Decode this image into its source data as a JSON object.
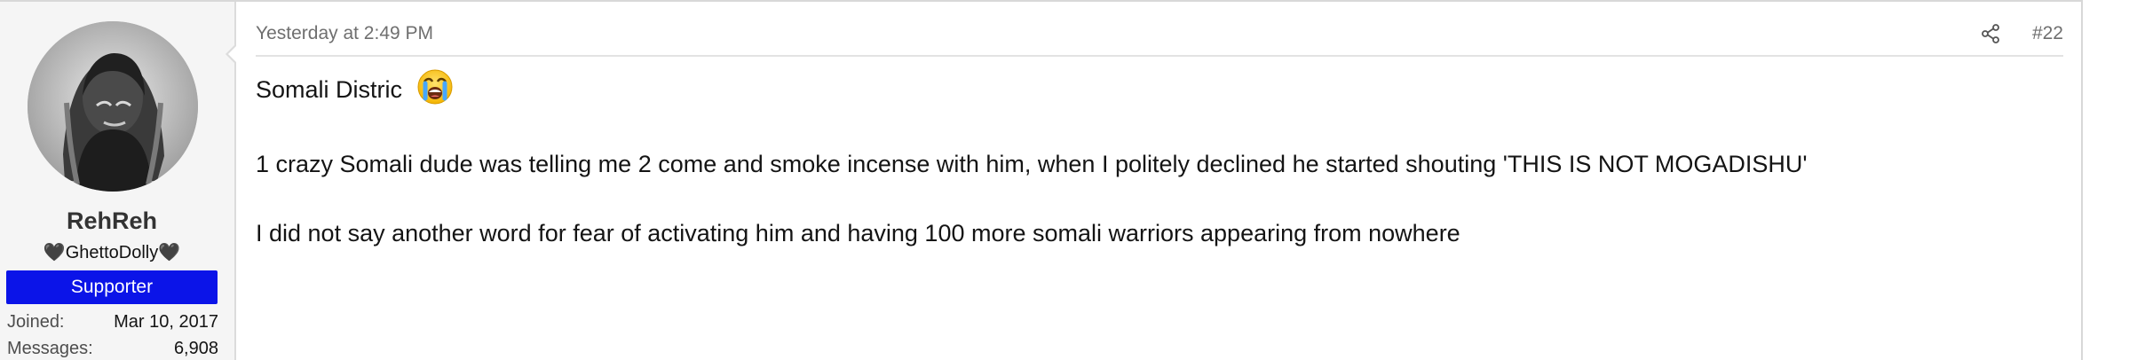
{
  "user": {
    "username": "RehReh",
    "custom_title": "🖤GhettoDolly🖤",
    "banner": "Supporter",
    "stats": {
      "joined_label": "Joined:",
      "joined_value": "Mar 10, 2017",
      "messages_label": "Messages:",
      "messages_value": "6,908"
    },
    "avatar_icon": "user-avatar"
  },
  "post": {
    "timestamp": "Yesterday at 2:49 PM",
    "share_icon": "share-icon",
    "number": "#22",
    "message": {
      "line1": "Somali Distric",
      "emoji": "loudly-crying-face-emoji",
      "line2": "1 crazy Somali dude was telling me 2 come and smoke incense with him, when I politely declined he started shouting 'THIS IS NOT MOGADISHU'",
      "line3": "I did not say another word for fear of activating him and having 100 more somali warriors appearing from nowhere"
    }
  },
  "colors": {
    "banner_bg": "#0b14e8",
    "sidebar_bg": "#f5f5f5",
    "muted_text": "#6f6f6f",
    "border": "#d8d8d8"
  }
}
